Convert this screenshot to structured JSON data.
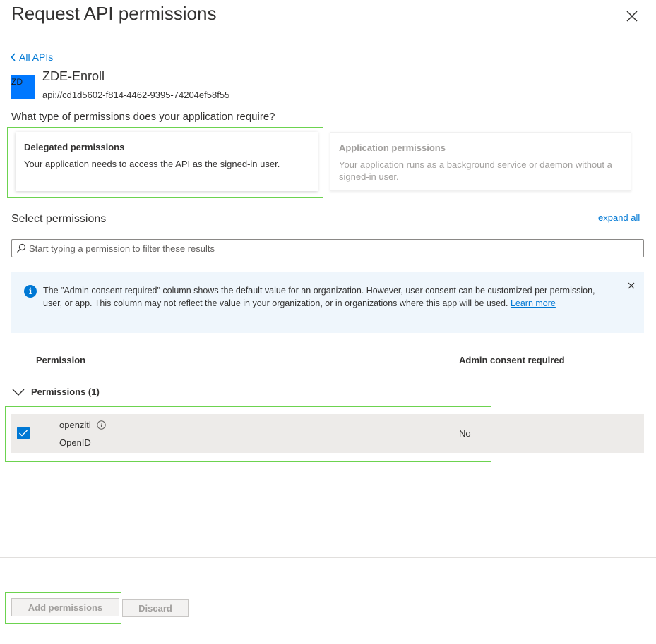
{
  "header": {
    "title": "Request API permissions",
    "close_icon": "close-icon"
  },
  "nav": {
    "back_label": "All APIs"
  },
  "api": {
    "tile_initials": "ZD",
    "name": "ZDE-Enroll",
    "uri": "api://cd1d5602-f814-4462-9395-74204ef58f55"
  },
  "permission_type": {
    "question": "What type of permissions does your application require?",
    "delegated": {
      "title": "Delegated permissions",
      "description": "Your application needs to access the API as the signed-in user."
    },
    "application": {
      "title": "Application permissions",
      "description": "Your application runs as a background service or daemon without a signed-in user."
    }
  },
  "select": {
    "label": "Select permissions",
    "expand_all": "expand all",
    "filter_placeholder": "Start typing a permission to filter these results"
  },
  "info_bar": {
    "text": "The \"Admin consent required\" column shows the default value for an organization. However, user consent can be customized per permission, user, or app. This column may not reflect the value in your organization, or in organizations where this app will be used.",
    "link": "Learn more"
  },
  "table": {
    "columns": [
      "Permission",
      "Admin consent required"
    ],
    "group_label": "Permissions (1)",
    "rows": [
      {
        "name": "openziti",
        "description": "OpenID",
        "admin_consent": "No",
        "checked": true
      }
    ]
  },
  "footer": {
    "add_label": "Add permissions",
    "discard_label": "Discard"
  },
  "colors": {
    "accent": "#0078d4",
    "highlight": "#6cd34f",
    "info_background": "#eff6fc"
  }
}
